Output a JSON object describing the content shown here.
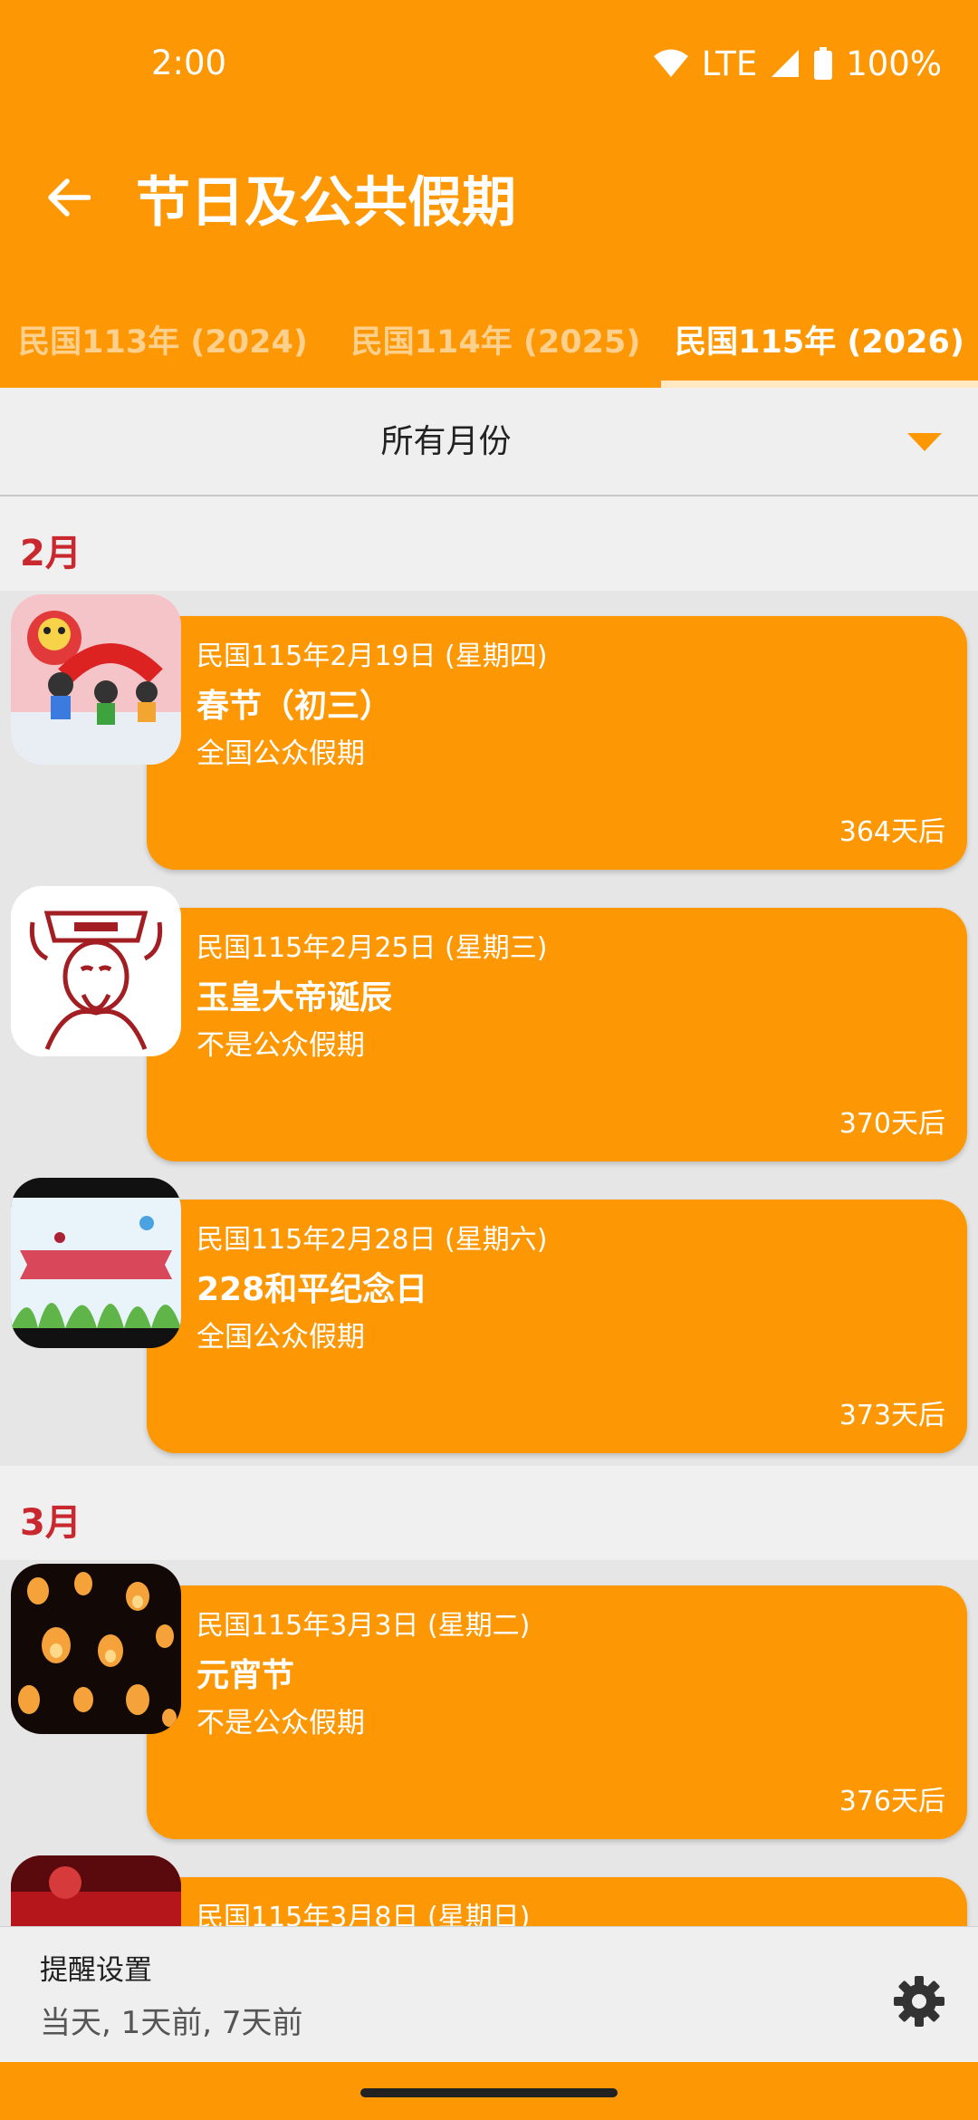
{
  "colors": {
    "primary": "#fd9804",
    "month_label": "#c8282e",
    "text_light": "#ffffff"
  },
  "status_bar": {
    "time": "2:00",
    "network": "LTE",
    "battery": "100%",
    "icons": [
      "wifi-icon",
      "cell-signal-icon",
      "battery-icon"
    ]
  },
  "toolbar": {
    "back_icon": "arrow-left-icon",
    "title": "节日及公共假期"
  },
  "tabs": [
    {
      "label": "民国113年 (2024)",
      "active": false
    },
    {
      "label": "民国114年 (2025)",
      "active": false
    },
    {
      "label": "民国115年 (2026)",
      "active": true
    }
  ],
  "month_filter": {
    "selected": "所有月份",
    "icon": "dropdown-arrow-icon"
  },
  "months": [
    {
      "label": "2月",
      "events": [
        {
          "date": "民国115年2月19日 (星期四)",
          "name": "春节（初三）",
          "status": "全国公众假期",
          "days": "364天后",
          "icon": "lion-dance-image"
        },
        {
          "date": "民国115年2月25日 (星期三)",
          "name": "玉皇大帝诞辰",
          "status": "不是公众假期",
          "days": "370天后",
          "icon": "jade-emperor-papercut-image"
        },
        {
          "date": "民国115年2月28日 (星期六)",
          "name": "228和平纪念日",
          "status": "全国公众假期",
          "days": "373天后",
          "icon": "peace-memorial-banner-image"
        }
      ]
    },
    {
      "label": "3月",
      "events": [
        {
          "date": "民国115年3月3日 (星期二)",
          "name": "元宵节",
          "status": "不是公众假期",
          "days": "376天后",
          "icon": "sky-lanterns-image"
        },
        {
          "date": "民国115年3月8日 (星期日)",
          "name": "",
          "status": "",
          "days": "",
          "icon": "red-festival-image"
        }
      ]
    }
  ],
  "reminder": {
    "title": "提醒设置",
    "value": "当天, 1天前, 7天前",
    "icon": "gear-icon"
  }
}
